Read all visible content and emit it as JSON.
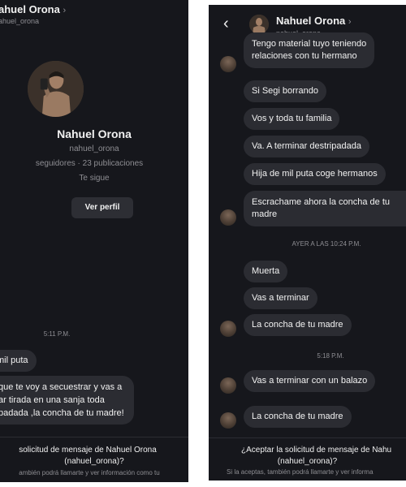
{
  "left": {
    "header": {
      "name": "ahuel Orona",
      "username": "ahuel_orona"
    },
    "profile": {
      "name": "Nahuel Orona",
      "username": "nahuel_orona",
      "stats": "seguidores · 23 publicaciones",
      "follow_status": "Te sigue",
      "view_profile_label": "Ver perfil"
    },
    "timestamp": "5:11 P.M.",
    "messages": [
      {
        "lines": [
          "mil puta"
        ]
      },
      {
        "lines": [
          "que te voy a secuestrar y vas a",
          "ar tirada en una sanja toda",
          "padada ,la concha de tu madre!"
        ]
      }
    ],
    "footer": {
      "line1": "solicitud de mensaje de Nahuel Orona",
      "line2": "(nahuel_orona)?",
      "line3": "ambién podrá llamarte y ver información como tu"
    }
  },
  "right": {
    "header": {
      "name": "Nahuel Orona",
      "username": "nahuel_orona"
    },
    "messages_top": [
      {
        "lines": [
          "Tengo material tuyo teniendo",
          "relaciones con tu hermano"
        ]
      },
      {
        "lines": [
          "Si Segi borrando"
        ]
      },
      {
        "lines": [
          "Vos y toda tu familia"
        ]
      },
      {
        "lines": [
          "Va. A terminar destripadada"
        ]
      },
      {
        "lines": [
          "Hija de mil puta coge hermanos"
        ]
      },
      {
        "lines": [
          "Escrachame ahora la concha de tu",
          "madre"
        ]
      }
    ],
    "timestamp_1": "AYER A LAS 10:24 P.M.",
    "messages_mid": [
      {
        "lines": [
          "Muerta"
        ]
      },
      {
        "lines": [
          "Vas a terminar"
        ]
      },
      {
        "lines": [
          "La concha de tu madre"
        ]
      }
    ],
    "timestamp_2": "5:18 P.M.",
    "messages_bottom": [
      {
        "lines": [
          "Vas a terminar con un balazo"
        ]
      },
      {
        "lines": [
          "La concha de tu madre"
        ]
      }
    ],
    "footer": {
      "line1": "¿Aceptar la solicitud de mensaje de Nahu",
      "line2": "(nahuel_orona)?",
      "line3": "Si la aceptas, también podrá llamarte y ver informa"
    }
  },
  "colors": {
    "background": "#16171c",
    "bubble": "#2b2c32",
    "text": "#f1f1f1",
    "muted": "#8e8e93",
    "button": "#2d2e34"
  },
  "icons": [
    "back-arrow-icon",
    "chevron-right-icon"
  ]
}
